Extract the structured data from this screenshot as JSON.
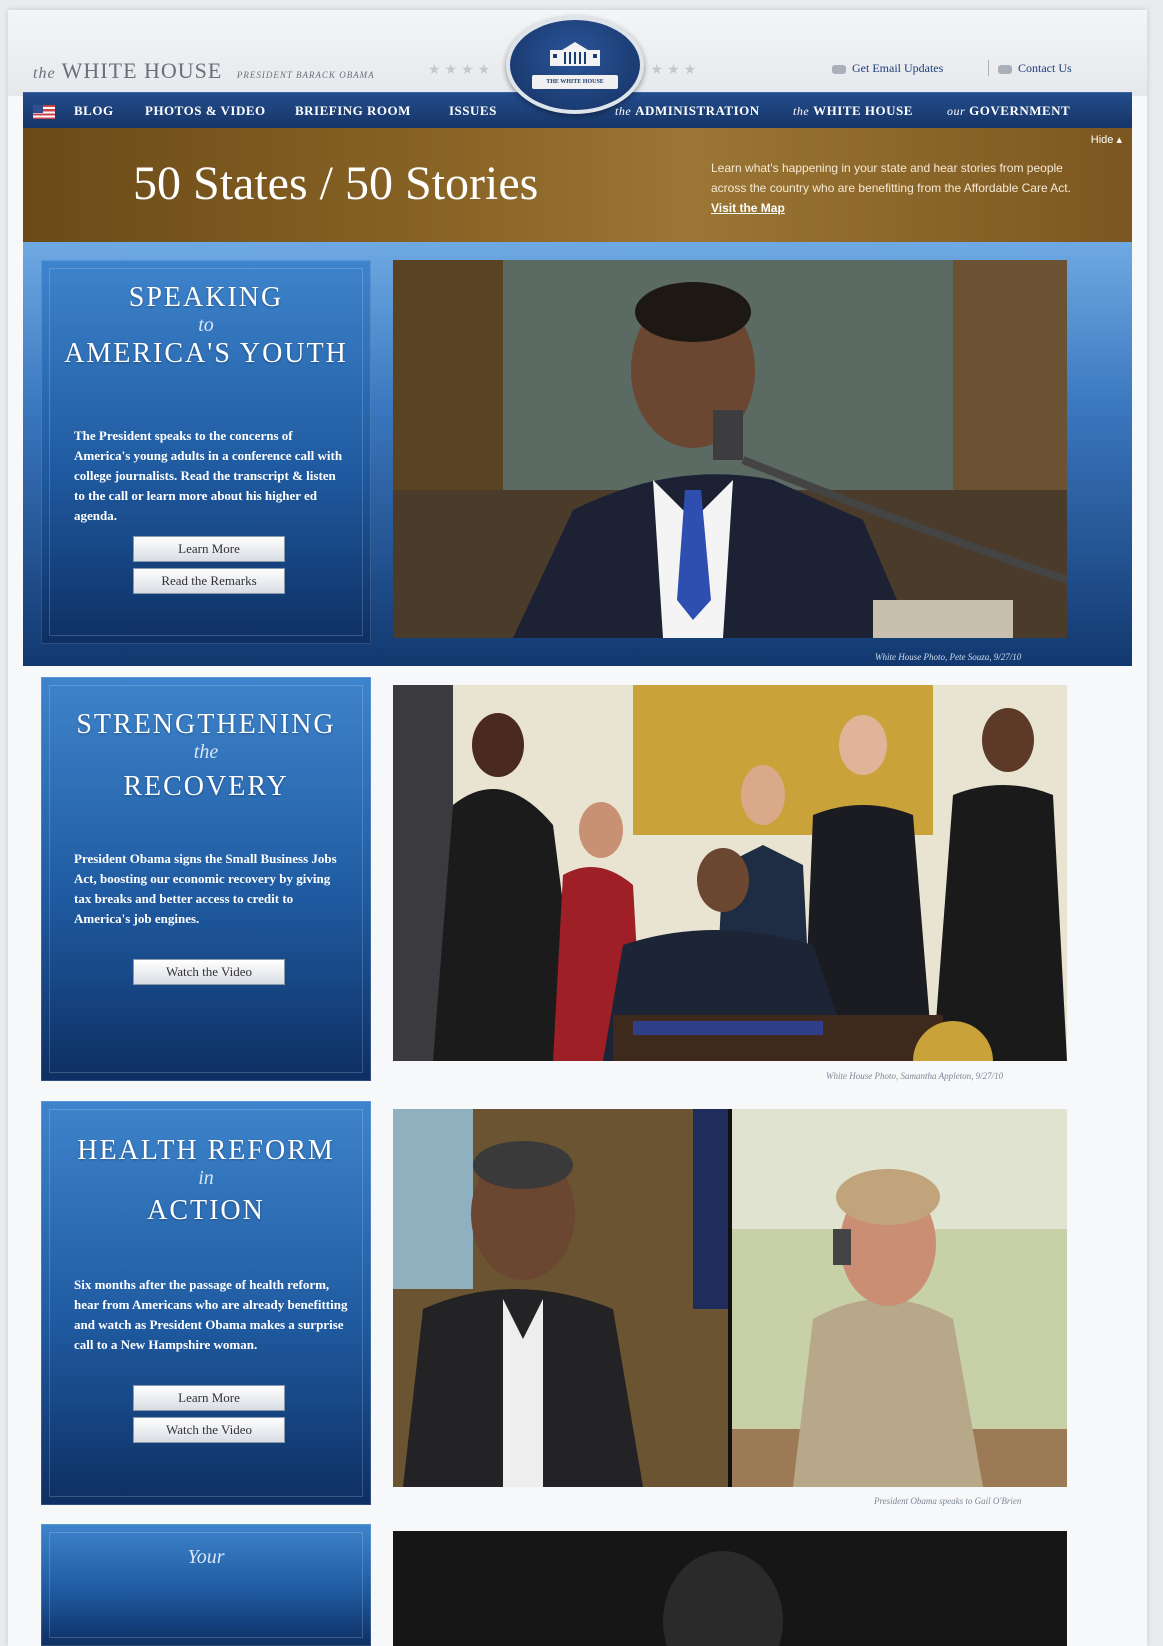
{
  "header": {
    "brand_the": "the",
    "brand_name": "WHITE HOUSE",
    "brand_sub": "PRESIDENT BARACK OBAMA",
    "seal_label": "THE WHITE HOUSE",
    "email_updates": "Get Email Updates",
    "contact": "Contact Us"
  },
  "nav": {
    "items": [
      "BLOG",
      "PHOTOS & VIDEO",
      "BRIEFING ROOM",
      "ISSUES"
    ],
    "right": [
      {
        "prefix": "the",
        "label": "ADMINISTRATION"
      },
      {
        "prefix": "the",
        "label": "WHITE HOUSE"
      },
      {
        "prefix": "our",
        "label": "GOVERNMENT"
      }
    ]
  },
  "banner": {
    "title": "50 States / 50 Stories",
    "text": "Learn what's happening in your state and hear stories from people across the country who are benefitting from the Affordable Care Act.",
    "link": "Visit the Map",
    "hide": "Hide"
  },
  "features": [
    {
      "title_top": "SPEAKING",
      "connector": "to",
      "title_bottom": "AMERICA'S YOUTH",
      "description": "The President speaks to the concerns of America's young adults in a conference call with college journalists. Read the transcript & listen to the call or learn more about his higher ed agenda.",
      "buttons": [
        "Learn More",
        "Read the Remarks"
      ],
      "credit": "White House Photo, Pete Souza, 9/27/10"
    },
    {
      "title_top": "STRENGTHENING",
      "connector": "the",
      "title_bottom": "RECOVERY",
      "description": "President Obama signs the Small Business Jobs Act, boosting our economic recovery by giving tax breaks and better access to credit to America's job engines.",
      "buttons": [
        "Watch the Video"
      ],
      "credit": "White House Photo, Samantha Appleton, 9/27/10"
    },
    {
      "title_top": "HEALTH REFORM",
      "connector": "in",
      "title_bottom": "ACTION",
      "description": "Six months after the passage of health reform, hear from Americans who are already benefitting and watch as President Obama makes a surprise call to a New Hampshire woman.",
      "buttons": [
        "Learn More",
        "Watch the Video"
      ],
      "credit": "President Obama speaks to Gail O'Brien"
    },
    {
      "connector": "Your"
    }
  ]
}
